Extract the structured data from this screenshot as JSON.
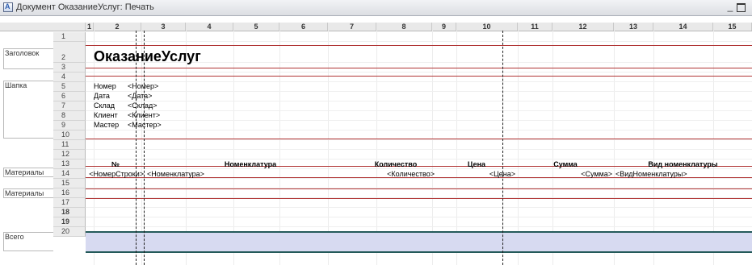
{
  "window": {
    "title": "Документ ОказаниеУслуг: Печать",
    "minimize_glyph": "_"
  },
  "columns": [
    "1",
    "2",
    "3",
    "4",
    "5",
    "6",
    "7",
    "8",
    "9",
    "10",
    "11",
    "12",
    "13",
    "14",
    "15"
  ],
  "rows": [
    "1",
    "2",
    "3",
    "4",
    "5",
    "6",
    "7",
    "8",
    "9",
    "10",
    "11",
    "12",
    "13",
    "14",
    "15",
    "16",
    "17",
    "18",
    "19",
    "20"
  ],
  "sections": {
    "header": "Заголовок",
    "cap": "Шапка",
    "materials_head": "Материалы",
    "materials_row": "Материалы",
    "total": "Всего"
  },
  "document": {
    "title": "ОказаниеУслуг",
    "fields": [
      {
        "label": "Номер",
        "value": "<Номер>"
      },
      {
        "label": "Дата",
        "value": "<Дата>"
      },
      {
        "label": "Склад",
        "value": "<Склад>"
      },
      {
        "label": "Клиент",
        "value": "<Клиент>"
      },
      {
        "label": "Мастер",
        "value": "<Мастер>"
      }
    ],
    "table_headers": [
      "№",
      "Номенклатура",
      "Количество",
      "Цена",
      "Сумма",
      "Вид номенклатуры"
    ],
    "table_params": [
      "<НомерСтроки>",
      "<Номенклатура>",
      "<Количество>",
      "<Цена>",
      "<Сумма>",
      "<ВидНоменклатуры>"
    ]
  }
}
